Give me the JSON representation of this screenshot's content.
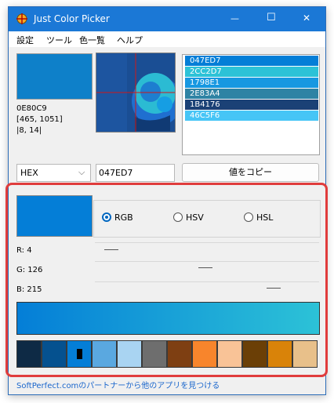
{
  "window": {
    "title": "Just Color Picker",
    "buttons": {
      "minimize": "—",
      "maximize": "☐",
      "close": "✕"
    }
  },
  "menu": [
    "設定",
    "ツール",
    "色一覧",
    "ヘルプ"
  ],
  "preview": {
    "color": "#0E80C9",
    "hex": "0E80C9",
    "coords": "[465, 1051]",
    "offset": "|8, 14|"
  },
  "history": [
    {
      "hex": "047ED7",
      "color": "#047ED7"
    },
    {
      "hex": "2CC2D7",
      "color": "#2CC2D7"
    },
    {
      "hex": "1798E1",
      "color": "#1798E1"
    },
    {
      "hex": "2E83A4",
      "color": "#2E83A4"
    },
    {
      "hex": "1B4176",
      "color": "#1B4176"
    },
    {
      "hex": "46C5F6",
      "color": "#46C5F6"
    }
  ],
  "format": {
    "selected": "HEX",
    "arrow": "⌵"
  },
  "value_field": "047ED7",
  "copy_button": "値をコピー",
  "current": {
    "color": "#047ED7"
  },
  "modes": [
    {
      "label": "RGB",
      "selected": true
    },
    {
      "label": "HSV",
      "selected": false
    },
    {
      "label": "HSL",
      "selected": false
    }
  ],
  "channels": [
    {
      "label": "R: 4",
      "value": 4
    },
    {
      "label": "G: 126",
      "value": 126
    },
    {
      "label": "B: 215",
      "value": 215
    }
  ],
  "gradient": {
    "from": "#047ED7",
    "to": "#2CC2D7"
  },
  "palette": [
    {
      "color": "#0E2A45"
    },
    {
      "color": "#05518F"
    },
    {
      "color": "#047ED7",
      "marked": true
    },
    {
      "color": "#5AA8E0"
    },
    {
      "color": "#A9D4F2"
    },
    {
      "color": "#6E6E6E"
    },
    {
      "color": "#7E3F12"
    },
    {
      "color": "#F8852C"
    },
    {
      "color": "#F9C397"
    },
    {
      "color": "#6B3F06"
    },
    {
      "color": "#D98309"
    },
    {
      "color": "#E8C08A"
    }
  ],
  "footer_link": "SoftPerfect.comのパートナーから他のアプリを見つける"
}
